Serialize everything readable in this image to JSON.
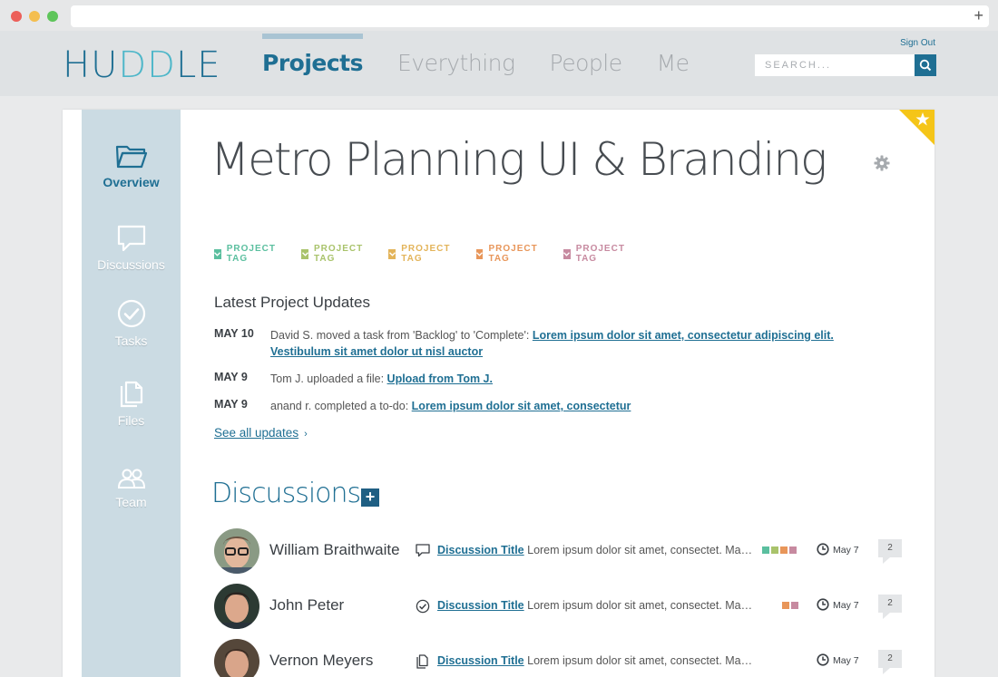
{
  "app": {
    "logo": {
      "part1": "HU",
      "part2": "DD",
      "part3": "LE"
    },
    "nav": [
      {
        "label": "Projects",
        "active": true
      },
      {
        "label": "Everything",
        "active": false
      },
      {
        "label": "People",
        "active": false
      },
      {
        "label": "Me",
        "active": false
      }
    ],
    "signout_label": "Sign Out",
    "search": {
      "placeholder": "SEARCH..."
    },
    "colors": {
      "brand": "#1f6f93",
      "sidebar": "#cbdbe3",
      "ribbon": "#f5c518"
    }
  },
  "sidebar": {
    "items": [
      {
        "label": "Overview",
        "icon": "folder-icon",
        "active": true
      },
      {
        "label": "Discussions",
        "icon": "speech-bubble-icon",
        "active": false
      },
      {
        "label": "Tasks",
        "icon": "check-circle-icon",
        "active": false
      },
      {
        "label": "Files",
        "icon": "files-icon",
        "active": false
      },
      {
        "label": "Team",
        "icon": "team-icon",
        "active": false
      }
    ]
  },
  "project": {
    "title": "Metro Planning UI & Branding",
    "tags": [
      {
        "label": "PROJECT TAG",
        "color": "#5bbf9f"
      },
      {
        "label": "PROJECT TAG",
        "color": "#a9c36b"
      },
      {
        "label": "PROJECT TAG",
        "color": "#e3b45a"
      },
      {
        "label": "PROJECT TAG",
        "color": "#e8965a"
      },
      {
        "label": "PROJECT TAG",
        "color": "#c78aa0"
      }
    ]
  },
  "updates": {
    "title": "Latest Project Updates",
    "items": [
      {
        "date": "MAY 10",
        "text": "David S. moved a task from 'Backlog' to 'Complete': ",
        "link": "Lorem ipsum dolor sit amet, consectetur adipiscing elit. Vestibulum sit amet dolor ut nisl auctor"
      },
      {
        "date": "MAY 9",
        "text": "Tom J. uploaded a file: ",
        "link": "Upload from Tom J."
      },
      {
        "date": "MAY 9",
        "text": "anand r. completed a to-do: ",
        "link": "Lorem ipsum dolor sit amet, consectetur "
      }
    ],
    "see_all": "See all updates"
  },
  "discussions": {
    "title": "Discussions",
    "add_label": "+",
    "items": [
      {
        "name": "William Braithwaite",
        "icon": "speech-bubble-icon",
        "link": "Discussion Title",
        "text": " Lorem ipsum dolor sit amet, consectet. Mauris et pretium",
        "swatches": [
          "#5bbf9f",
          "#a9c36b",
          "#e8965a",
          "#c78aa0"
        ],
        "date": "May 7",
        "count": "2"
      },
      {
        "name": "John Peter",
        "icon": "check-circle-icon",
        "link": "Discussion Title",
        "text": " Lorem ipsum dolor sit amet, consectet. Mauris et pretium",
        "swatches": [
          "#e8965a",
          "#c78aa0"
        ],
        "date": "May 7",
        "count": "2"
      },
      {
        "name": "Vernon Meyers",
        "icon": "files-icon",
        "link": "Discussion Title",
        "text": " Lorem ipsum dolor sit amet, consectet. Mauris et pretium",
        "swatches": [],
        "date": "May 7",
        "count": "2"
      }
    ]
  }
}
